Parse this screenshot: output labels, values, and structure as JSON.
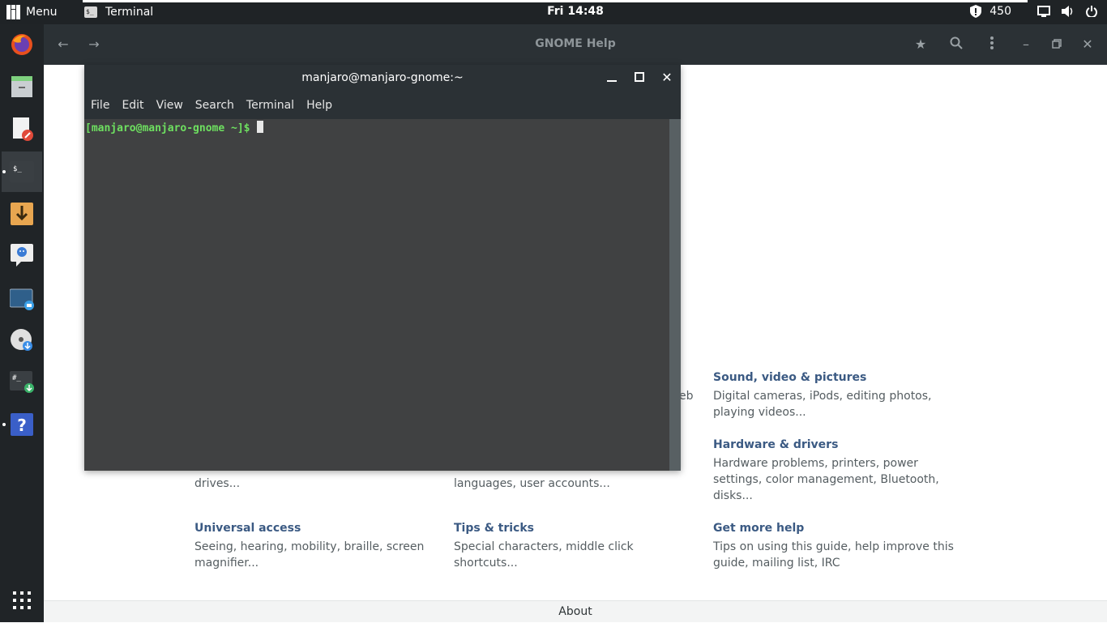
{
  "top_panel": {
    "menu_label": "Menu",
    "task_label": "Terminal",
    "clock": "Fri 14:48",
    "updates_count": "450"
  },
  "dock": {
    "items": [
      {
        "name": "firefox",
        "active": false
      },
      {
        "name": "file-manager",
        "active": false
      },
      {
        "name": "text-editor",
        "active": false
      },
      {
        "name": "terminal",
        "active": true
      },
      {
        "name": "downloader",
        "active": false
      },
      {
        "name": "chat",
        "active": false
      },
      {
        "name": "screenshot",
        "active": false
      },
      {
        "name": "disc-burner",
        "active": false
      },
      {
        "name": "root-terminal",
        "active": false
      },
      {
        "name": "help",
        "active": true
      }
    ]
  },
  "help_window": {
    "title": "GNOME Help",
    "topics": [
      {
        "title": "Sound, video & pictures",
        "desc": "Digital cameras, iPods, editing photos, playing videos..."
      },
      {
        "title": "Hardware & drivers",
        "desc": "Hardware problems, printers, power settings, color management, Bluetooth, disks..."
      },
      {
        "title": "",
        "desc": "drives..."
      },
      {
        "title": "",
        "desc": "languages, user accounts..."
      },
      {
        "title": "Universal access",
        "desc": "Seeing, hearing, mobility, braille, screen magnifier..."
      },
      {
        "title": "Tips & tricks",
        "desc": "Special characters, middle click shortcuts..."
      },
      {
        "title": "Get more help",
        "desc": "Tips on using this guide, help improve this guide, mailing list, IRC"
      }
    ],
    "partial_text": "eb",
    "about_label": "About"
  },
  "terminal": {
    "title": "manjaro@manjaro-gnome:~",
    "menu": [
      "File",
      "Edit",
      "View",
      "Search",
      "Terminal",
      "Help"
    ],
    "prompt": "[manjaro@manjaro-gnome ~]$ "
  }
}
